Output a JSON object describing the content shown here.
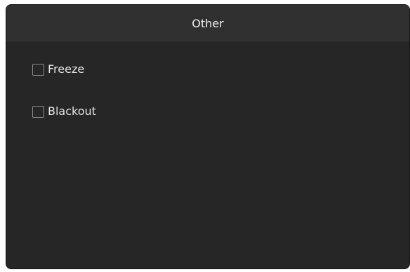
{
  "panel": {
    "title": "Other",
    "options": [
      {
        "label": "Freeze",
        "checked": false
      },
      {
        "label": "Blackout",
        "checked": false
      }
    ]
  },
  "colors": {
    "background": "#262626",
    "header": "#303030",
    "text": "#e6e6e6",
    "checkbox_border": "#8a8a8a"
  }
}
